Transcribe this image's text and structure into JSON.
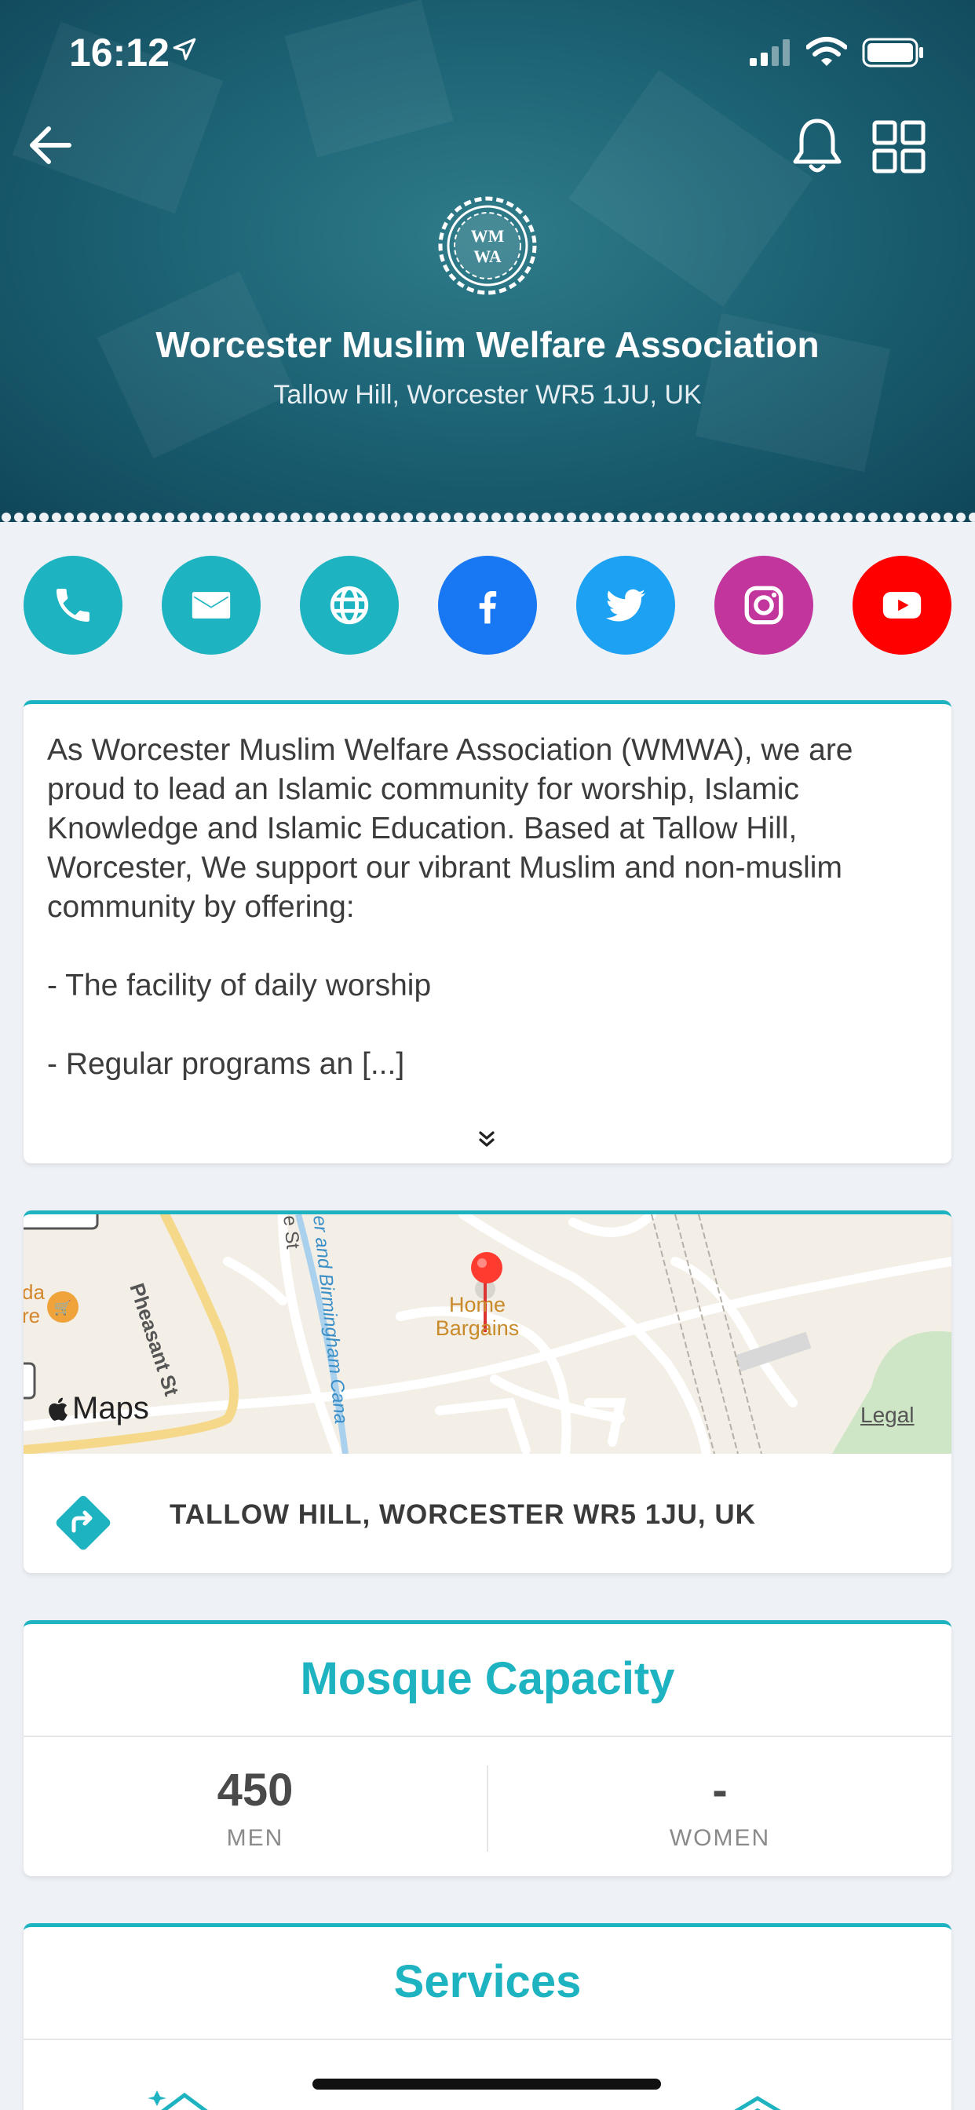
{
  "status_bar": {
    "time": "16:12"
  },
  "header": {
    "logo_text": "WM WA",
    "title": "Worcester Muslim Welfare Association",
    "address": "Tallow Hill, Worcester WR5 1JU, UK"
  },
  "social": [
    {
      "icon": "phone-icon",
      "color": "#1eb3c0"
    },
    {
      "icon": "email-icon",
      "color": "#1eb3c0"
    },
    {
      "icon": "globe-icon",
      "color": "#1eb3c0"
    },
    {
      "icon": "facebook-icon",
      "color": "#1877f2"
    },
    {
      "icon": "twitter-icon",
      "color": "#1da1f2"
    },
    {
      "icon": "instagram-icon",
      "color": "#c1359c"
    },
    {
      "icon": "youtube-icon",
      "color": "#ff0000"
    }
  ],
  "description": {
    "text": "As Worcester Muslim Welfare Association (WMWA), we are proud to lead an Islamic community for worship, Islamic Knowledge and Islamic Education. Based at Tallow Hill, Worcester, We support our vibrant Muslim and non-muslim community by offering:\n\n- The facility of daily worship\n\n- Regular programs an [...]"
  },
  "map": {
    "place_label": "Home Bargains",
    "street_1": "Pheasant St",
    "street_2": "er and Birmingham Cana",
    "street_3": "e St",
    "left_fragment": "da re",
    "brand": "Maps",
    "legal": "Legal",
    "address": "TALLOW HILL, WORCESTER WR5 1JU, UK"
  },
  "capacity": {
    "title": "Mosque Capacity",
    "men_value": "450",
    "men_label": "MEN",
    "women_value": "-",
    "women_label": "WOMEN"
  },
  "services": {
    "title": "Services"
  },
  "colors": {
    "accent": "#1eb3c0",
    "header": "#1d6476"
  }
}
